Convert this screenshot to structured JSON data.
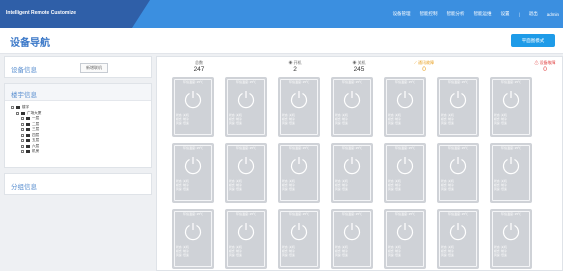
{
  "app": {
    "brand": "Intelligent Remote Customize",
    "nav": [
      "设备管理",
      "智能控制",
      "智能分析",
      "智能运维",
      "设置",
      "|",
      "退出",
      "admin"
    ]
  },
  "page": {
    "title": "设备导航",
    "mode_button": "平面图模式"
  },
  "left": {
    "device_info_title": "设备信息",
    "device_info_button": "新增联机",
    "building_title": "楼宇信息",
    "tree": [
      {
        "label": "楼宇",
        "level": 0
      },
      {
        "label": "广场大厦",
        "level": 1
      },
      {
        "label": "一层",
        "level": 2
      },
      {
        "label": "二层",
        "level": 2
      },
      {
        "label": "三层",
        "level": 2
      },
      {
        "label": "四层",
        "level": 2
      },
      {
        "label": "五层",
        "level": 2
      },
      {
        "label": "六层",
        "level": 2
      },
      {
        "label": "机房",
        "level": 2
      }
    ],
    "group_title": "分组信息"
  },
  "stats": [
    {
      "label": "总数",
      "value": "247",
      "kind": "total",
      "icon": ""
    },
    {
      "label": "开机",
      "value": "2",
      "kind": "on",
      "icon": "power-on-icon"
    },
    {
      "label": "关机",
      "value": "245",
      "kind": "off",
      "icon": "power-off-icon"
    },
    {
      "label": "通讯故障",
      "value": "0",
      "kind": "warn",
      "icon": "signal-fault-icon"
    },
    {
      "label": "设备故障",
      "value": "0",
      "kind": "alarm",
      "icon": "alarm-icon"
    }
  ],
  "card_title": "环境温度: 25℃",
  "cards": [
    {
      "lines": [
        "状态: 关机",
        "模式: 制冷",
        "风速: 低速"
      ]
    },
    {
      "lines": [
        "状态: 关机",
        "模式: 制冷",
        "风速: 低速"
      ]
    },
    {
      "lines": [
        "状态: 关机",
        "模式: 制冷",
        "风速: 低速"
      ]
    },
    {
      "lines": [
        "状态: 关机",
        "模式: 制冷",
        "风速: 低速"
      ]
    },
    {
      "lines": [
        "状态: 关机",
        "模式: 制冷",
        "风速: 低速"
      ]
    },
    {
      "lines": [
        "状态: 关机",
        "模式: 制冷",
        "风速: 低速"
      ]
    },
    {
      "lines": [
        "状态: 关机",
        "模式: 制冷",
        "风速: 低速"
      ]
    },
    {
      "lines": [
        "状态: 关机",
        "模式: 制冷",
        "风速: 低速"
      ]
    },
    {
      "lines": [
        "状态: 关机",
        "模式: 制冷",
        "风速: 低速"
      ]
    },
    {
      "lines": [
        "状态: 关机",
        "模式: 制冷",
        "风速: 低速"
      ]
    },
    {
      "lines": [
        "状态: 关机",
        "模式: 制冷",
        "风速: 低速"
      ]
    },
    {
      "lines": [
        "状态: 关机",
        "模式: 制冷",
        "风速: 低速"
      ]
    },
    {
      "lines": [
        "状态: 关机",
        "模式: 制冷",
        "风速: 低速"
      ]
    },
    {
      "lines": [
        "状态: 关机",
        "模式: 制冷",
        "风速: 低速"
      ]
    },
    {
      "lines": [
        "状态: 关机",
        "模式: 制冷",
        "风速: 低速"
      ]
    },
    {
      "lines": [
        "状态: 关机",
        "模式: 制冷",
        "风速: 低速"
      ]
    },
    {
      "lines": [
        "状态: 关机",
        "模式: 制冷",
        "风速: 低速"
      ]
    },
    {
      "lines": [
        "状态: 关机",
        "模式: 制冷",
        "风速: 低速"
      ]
    },
    {
      "lines": [
        "状态: 关机",
        "模式: 制冷",
        "风速: 低速"
      ]
    },
    {
      "lines": [
        "状态: 关机",
        "模式: 制冷",
        "风速: 低速"
      ]
    },
    {
      "lines": [
        "状态: 关机",
        "模式: 制冷",
        "风速: 低速"
      ]
    }
  ],
  "colors": {
    "topbar": "#3b8fe0",
    "brand_bg": "#2f5fa8",
    "accent": "#1e9be8",
    "card": "#cfd2d7",
    "warn": "#e8a020",
    "alarm": "#e04040"
  }
}
